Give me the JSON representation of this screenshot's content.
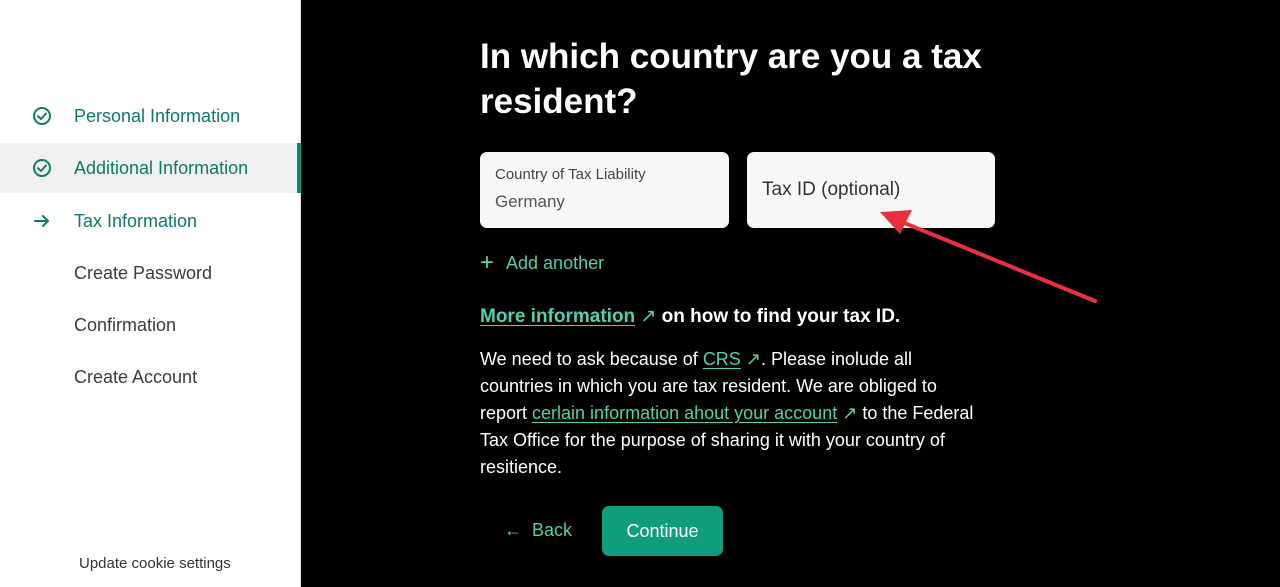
{
  "sidebar": {
    "steps": [
      {
        "label": "Personal Information",
        "state": "done",
        "icon": "check-circle-icon"
      },
      {
        "label": "Additional Information",
        "state": "done",
        "icon": "check-circle-icon"
      },
      {
        "label": "Tax Information",
        "state": "current",
        "icon": "arrow-right-icon"
      },
      {
        "label": "Create Password",
        "state": "todo"
      },
      {
        "label": "Confirmation",
        "state": "todo"
      },
      {
        "label": "Create Account",
        "state": "todo"
      }
    ],
    "cookie_link": "Update cookie settings"
  },
  "main": {
    "title": "In which country are you a tax resident?",
    "country_field": {
      "label": "Country of Tax Liability",
      "value": "Germany"
    },
    "tax_id_field": {
      "placeholder": "Tax ID (optional)"
    },
    "add_another": "Add another",
    "more_info": {
      "link": "More information",
      "rest": "on how to find your tax ID."
    },
    "paragraph": {
      "part1": "We need to ask because of ",
      "crs_link": "CRS",
      "part2": ". Please inolude all countries in which you are tax resident. We are obliged to report ",
      "info_link": "cerlain information ahout your account",
      "part3": " to the Federal Tax Office for the purpose of sharing it with your country of resitience."
    },
    "back_label": "Back",
    "continue_label": "Continue"
  },
  "colors": {
    "accent": "#4fd1b0",
    "button": "#0f9d7e",
    "sidebar_active_text": "#0c7a64",
    "annotation_arrow": "#e8303f"
  }
}
